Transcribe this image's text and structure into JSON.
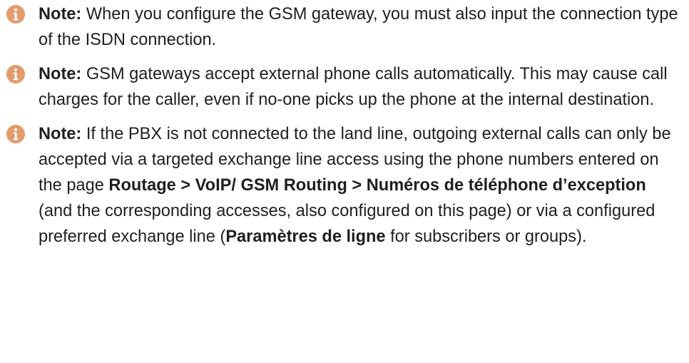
{
  "notes": [
    {
      "icon": "info-icon",
      "label": "Note:",
      "text": " When you configure the GSM gateway, you must also input the connection type of the ISDN connection."
    },
    {
      "icon": "info-icon",
      "label": "Note:",
      "text": " GSM gateways accept external phone calls automatically. This may cause call charges for the caller, even if no-one picks up the phone at the internal destination."
    },
    {
      "icon": "info-icon",
      "label": "Note:",
      "text_1": " If the PBX is not connected to the land line, outgoing external calls can only be accepted via a targeted exchange line access using the phone numbers entered on the page ",
      "link_path": "Routage > VoIP/ GSM Routing > Numéros de téléphone d’exception",
      "text_2": " (and the corresponding accesses, also configured on this page) or via a configured preferred exchange line (",
      "link_settings": "Paramètres de ligne",
      "text_3": " for subscribers or groups)."
    }
  ],
  "colors": {
    "icon_fill": "#e49b6c",
    "text": "#1f1f1f"
  }
}
